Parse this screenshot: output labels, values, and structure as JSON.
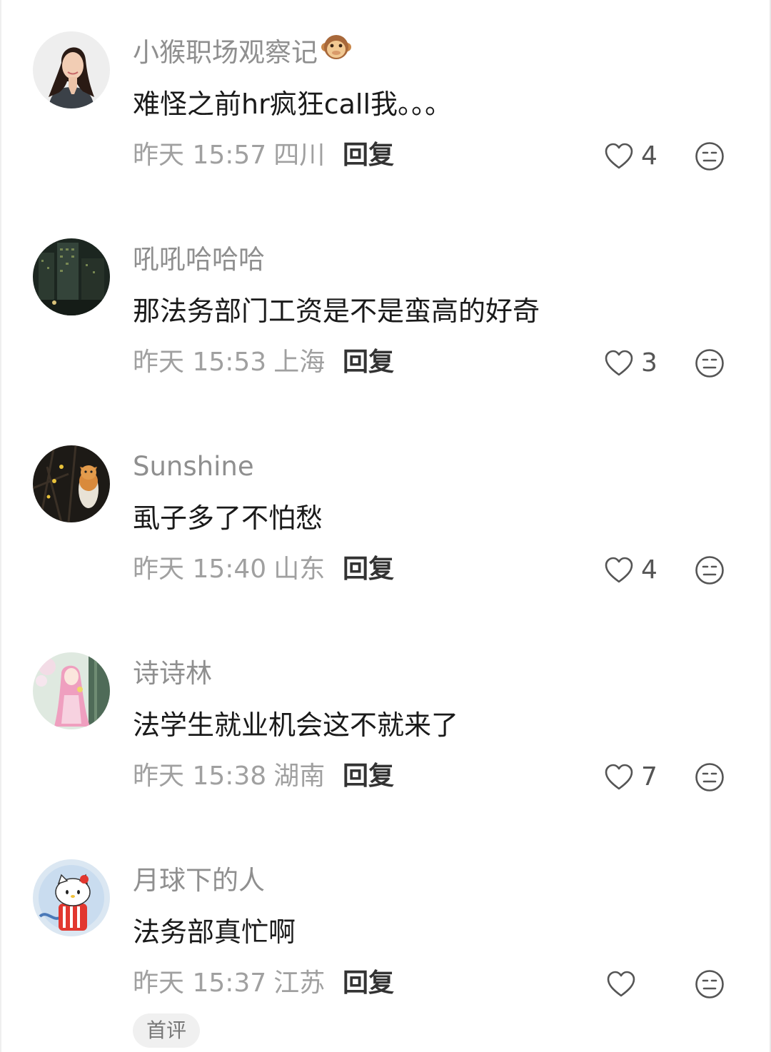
{
  "comments": [
    {
      "username": "小猴职场观察记",
      "username_emoji": "monkey-face-icon",
      "content": "难怪之前hr疯狂call我。。。",
      "time": "昨天 15:57",
      "location": "四川",
      "reply_label": "回复",
      "likes": "4",
      "avatar": "avatar-woman-portrait"
    },
    {
      "username": "吼吼哈哈哈",
      "content": "那法务部门工资是不是蛮高的好奇",
      "time": "昨天 15:53",
      "location": "上海",
      "reply_label": "回复",
      "likes": "3",
      "avatar": "avatar-city-night"
    },
    {
      "username": "Sunshine",
      "content": "虱子多了不怕愁",
      "time": "昨天 15:40",
      "location": "山东",
      "reply_label": "回复",
      "likes": "4",
      "avatar": "avatar-cat-on-tree"
    },
    {
      "username": "诗诗林",
      "content": "法学生就业机会这不就来了",
      "time": "昨天 15:38",
      "location": "湖南",
      "reply_label": "回复",
      "likes": "7",
      "avatar": "avatar-anime-girl-pink"
    },
    {
      "username": "月球下的人",
      "content": "法务部真忙啊",
      "time": "昨天 15:37",
      "location": "江苏",
      "reply_label": "回复",
      "likes": "",
      "avatar": "avatar-hello-kitty",
      "badge": "首评"
    }
  ],
  "colors": {
    "username": "#8f8f8f",
    "content": "#1a1a1a",
    "meta": "#a0a0a0",
    "reply": "#333333",
    "icon": "#555555"
  }
}
